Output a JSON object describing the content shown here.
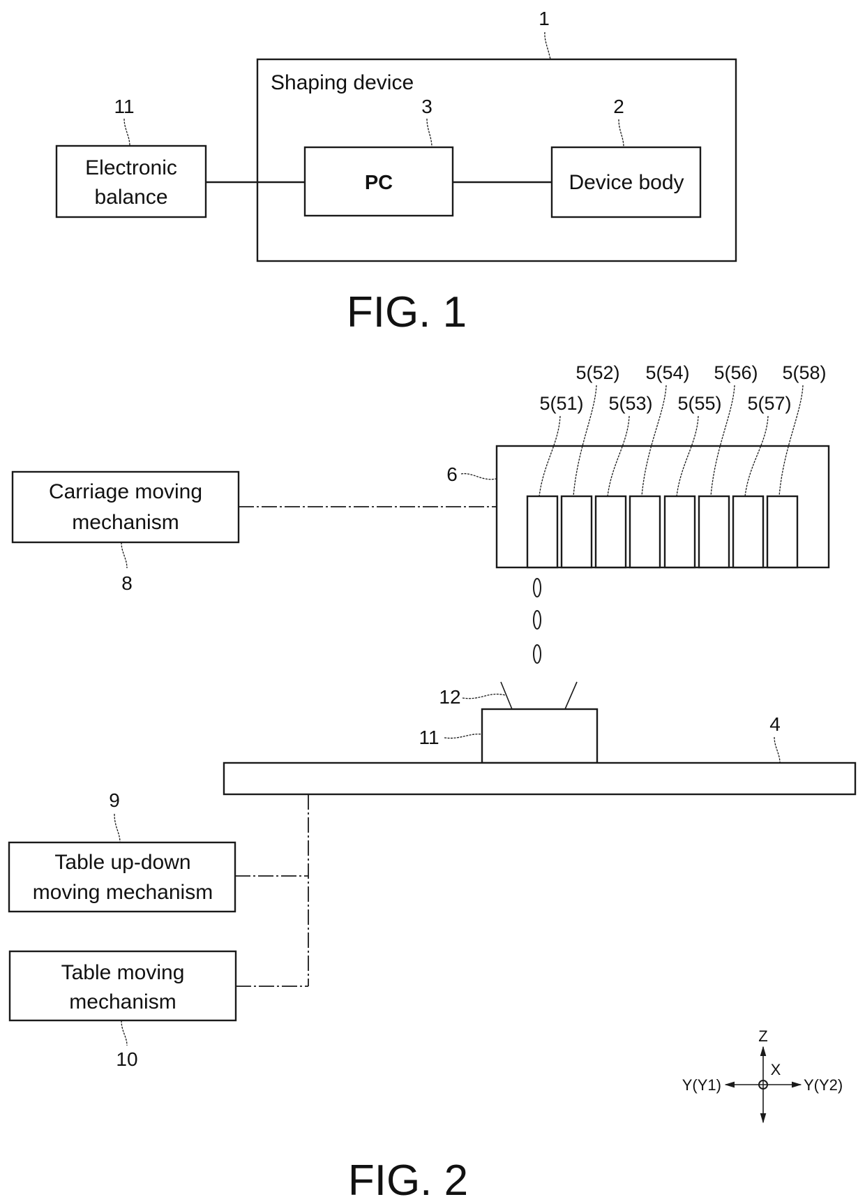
{
  "fig1": {
    "caption": "FIG. 1",
    "shaping_device": {
      "ref": "1",
      "label": "Shaping device"
    },
    "electronic_balance": {
      "ref": "11",
      "line1": "Electronic",
      "line2": "balance"
    },
    "pc": {
      "ref": "3",
      "label": "PC"
    },
    "device_body": {
      "ref": "2",
      "label": "Device body"
    }
  },
  "fig2": {
    "caption": "FIG. 2",
    "carriage_moving_mechanism": {
      "ref": "8",
      "line1": "Carriage moving",
      "line2": "mechanism"
    },
    "carriage": {
      "ref": "6"
    },
    "heads": [
      {
        "label": "5(51)"
      },
      {
        "label": "5(52)"
      },
      {
        "label": "5(53)"
      },
      {
        "label": "5(54)"
      },
      {
        "label": "5(55)"
      },
      {
        "label": "5(56)"
      },
      {
        "label": "5(57)"
      },
      {
        "label": "5(58)"
      }
    ],
    "shaped_object": {
      "ref": "12"
    },
    "balance": {
      "ref": "11"
    },
    "table": {
      "ref": "4"
    },
    "table_up_down_mechanism": {
      "ref": "9",
      "line1": "Table up-down",
      "line2": "moving mechanism"
    },
    "table_moving_mechanism": {
      "ref": "10",
      "line1": "Table moving",
      "line2": "mechanism"
    },
    "axes": {
      "z": "Z",
      "x": "X",
      "y_left": "Y(Y1)",
      "y_right": "Y(Y2)"
    }
  }
}
